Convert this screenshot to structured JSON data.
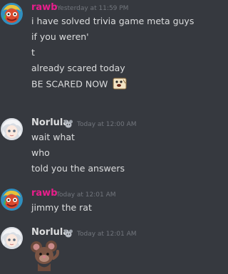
{
  "messages": [
    {
      "author": "rawb",
      "author_color": "#e91e8c",
      "timestamp": "Yesterday at 11:59 PM",
      "lines": [
        "i have solved trivia game meta guys",
        "if you weren'",
        "t",
        "already scared today",
        "BE SCARED NOW"
      ]
    },
    {
      "author": "Norlula",
      "author_color": "#dcddde",
      "timestamp": "Today at 12:00 AM",
      "lines": [
        "wait what",
        "who",
        "told you the answers"
      ]
    },
    {
      "author": "rawb",
      "author_color": "#e91e8c",
      "timestamp": "Today at 12:01 AM",
      "lines": [
        "jimmy the rat"
      ]
    },
    {
      "author": "Norlula",
      "author_color": "#dcddde",
      "timestamp": "Today at 12:01 AM",
      "lines": []
    }
  ],
  "icons": {
    "scared_emoji": "scared-face-emoji",
    "rat_emoji": "rat-sticker",
    "badge": "mouse-badge-icon"
  }
}
